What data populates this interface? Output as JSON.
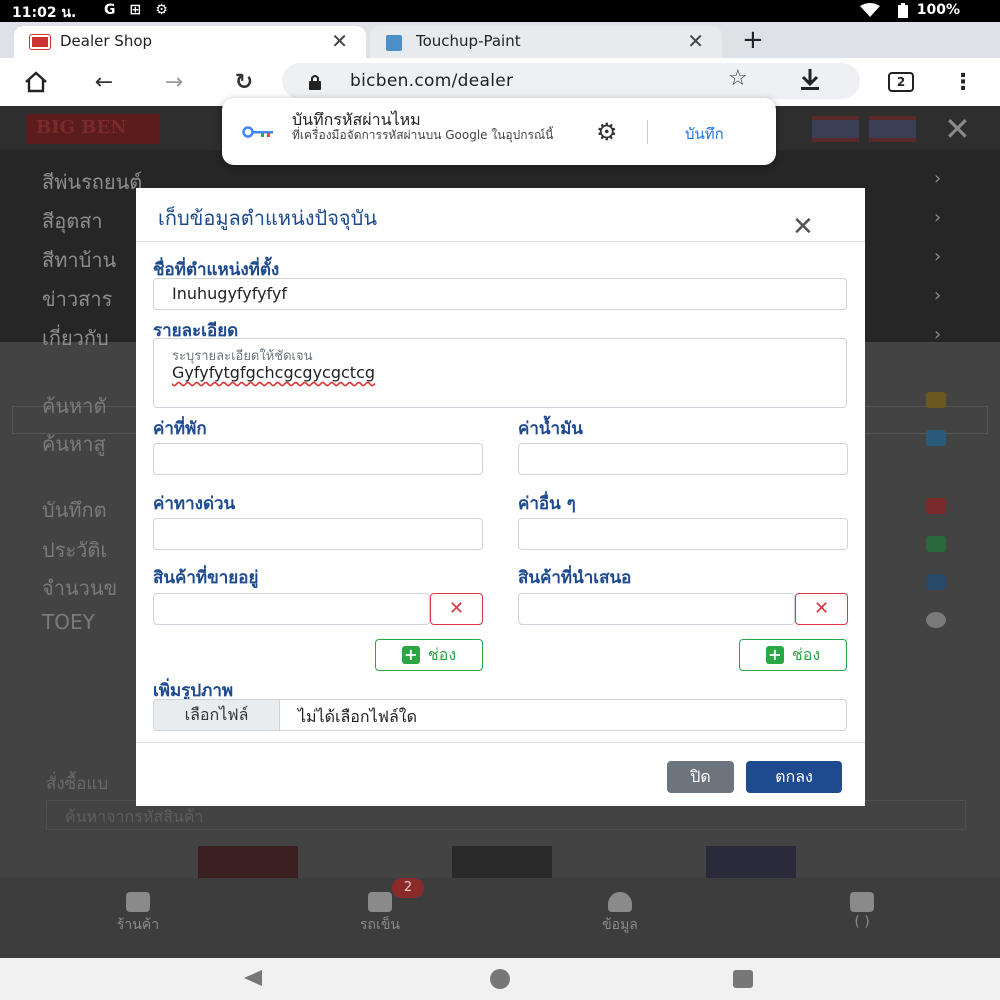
{
  "status_bar": {
    "time": "11:02 น.",
    "battery": "100%"
  },
  "tabs": [
    {
      "title": "Dealer Shop",
      "active": true
    },
    {
      "title": "Touchup-Paint",
      "active": false
    }
  ],
  "toolbar": {
    "url": "bicben.com/dealer",
    "tab_count": "2"
  },
  "password_prompt": {
    "title": "บันทึกรหัสผ่านไหม",
    "subtitle": "ที่เครื่องมือจัดการรหัสผ่านบน Google ในอุปกรณ์นี้",
    "save_label": "บันทึก"
  },
  "site": {
    "logo_text": "BIG BEN",
    "menu_items": [
      "สีพ่นรถยนต์",
      "สีอุตสา",
      "สีทาบ้าน",
      "ข่าวสาร",
      "เกี่ยวกับ"
    ],
    "side_items": [
      "ค้นหาตั",
      "ค้นหาสู",
      "บันทึกต",
      "ประวัติเ",
      "จำนวนข",
      "TOEY"
    ],
    "order_label": "สั่งซื้อแบ",
    "order_placeholder": "ค้นหาจากรหัสสินค้า",
    "bottom_nav": [
      {
        "label": "ร้านค้า"
      },
      {
        "label": "รถเข็น",
        "badge": "2"
      },
      {
        "label": "ข้อมูล"
      },
      {
        "label": "( )"
      }
    ]
  },
  "modal": {
    "title": "เก็บข้อมูลตำแหน่งปัจจุบัน",
    "location_name_label": "ชื่อที่ตำแหน่งที่ตั้ง",
    "location_name_value": "Inuhugyfyfyfyf",
    "details_label": "รายละเอียด",
    "details_placeholder": "ระบุรายละเอียดให้ชัดเจน",
    "details_value": "Gyfyfytgfgchcgcgycgctcg",
    "lodging_label": "ค่าที่พัก",
    "fuel_label": "ค่าน้ำมัน",
    "toll_label": "ค่าทางด่วน",
    "other_label": "ค่าอื่น ๆ",
    "products_sold_label": "สินค้าที่ขายอยู่",
    "products_offered_label": "สินค้าที่นำเสนอ",
    "delete_symbol": "✕",
    "add_slot_label": "ช่อง",
    "add_image_label": "เพิ่มรูปภาพ",
    "choose_file_label": "เลือกไฟล์",
    "no_file_label": "ไม่ได้เลือกไฟล์ใด",
    "close_label": "ปิด",
    "ok_label": "ตกลง"
  }
}
